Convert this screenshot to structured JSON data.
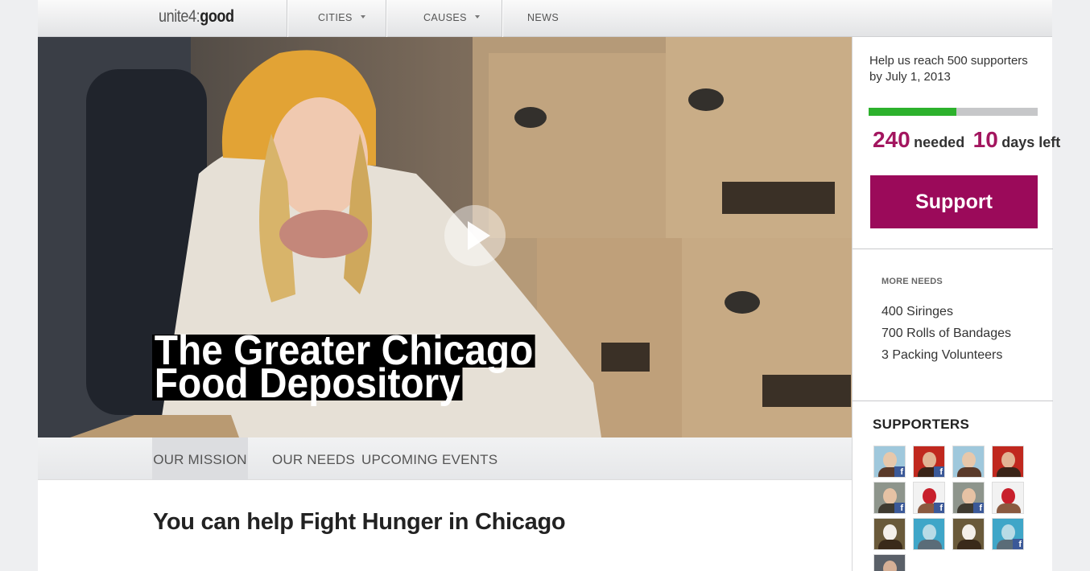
{
  "header": {
    "logo_light": "unite4:",
    "logo_bold": "good",
    "nav": [
      {
        "label": "CITIES",
        "dropdown": true
      },
      {
        "label": "CAUSES",
        "dropdown": true
      },
      {
        "label": "NEWS",
        "dropdown": false
      }
    ]
  },
  "hero": {
    "title_line1": "The Greater Chicago",
    "title_line2": "Food Depository",
    "play_icon": "play-icon"
  },
  "tabs": [
    {
      "label": "OUR MISSION",
      "active": true
    },
    {
      "label": "OUR NEEDS",
      "active": false
    },
    {
      "label": "UPCOMING EVENTS",
      "active": false
    }
  ],
  "main": {
    "heading": "You can help Fight Hunger in Chicago"
  },
  "campaign": {
    "goal_text": "Help us reach 500 supporters by July 1, 2013",
    "progress": 0.52,
    "needed_count": "240",
    "needed_label": "needed",
    "days_count": "10",
    "days_label": "days left",
    "support_label": "Support",
    "colors": {
      "accent": "#9b0a5a",
      "number": "#a3165f",
      "progress": "#2cb12c"
    }
  },
  "more_needs": {
    "title": "MORE NEEDS",
    "items": [
      "400 Siringes",
      "700 Rolls of Bandages",
      "3 Packing Volunteers"
    ]
  },
  "supporters": {
    "title": "SUPPORTERS",
    "avatars": [
      {
        "kind": "pool-woman",
        "facebook": true
      },
      {
        "kind": "red-man",
        "facebook": true
      },
      {
        "kind": "pool-woman",
        "facebook": false
      },
      {
        "kind": "red-man",
        "facebook": false
      },
      {
        "kind": "man-gray",
        "facebook": true
      },
      {
        "kind": "flag-collage",
        "facebook": true
      },
      {
        "kind": "man-gray",
        "facebook": true
      },
      {
        "kind": "flag-collage",
        "facebook": false
      },
      {
        "kind": "wedding",
        "facebook": false
      },
      {
        "kind": "dolphin",
        "facebook": false
      },
      {
        "kind": "wedding",
        "facebook": false
      },
      {
        "kind": "dolphin",
        "facebook": true
      },
      {
        "kind": "man-dark",
        "facebook": false
      }
    ],
    "facebook_glyph": "f"
  }
}
